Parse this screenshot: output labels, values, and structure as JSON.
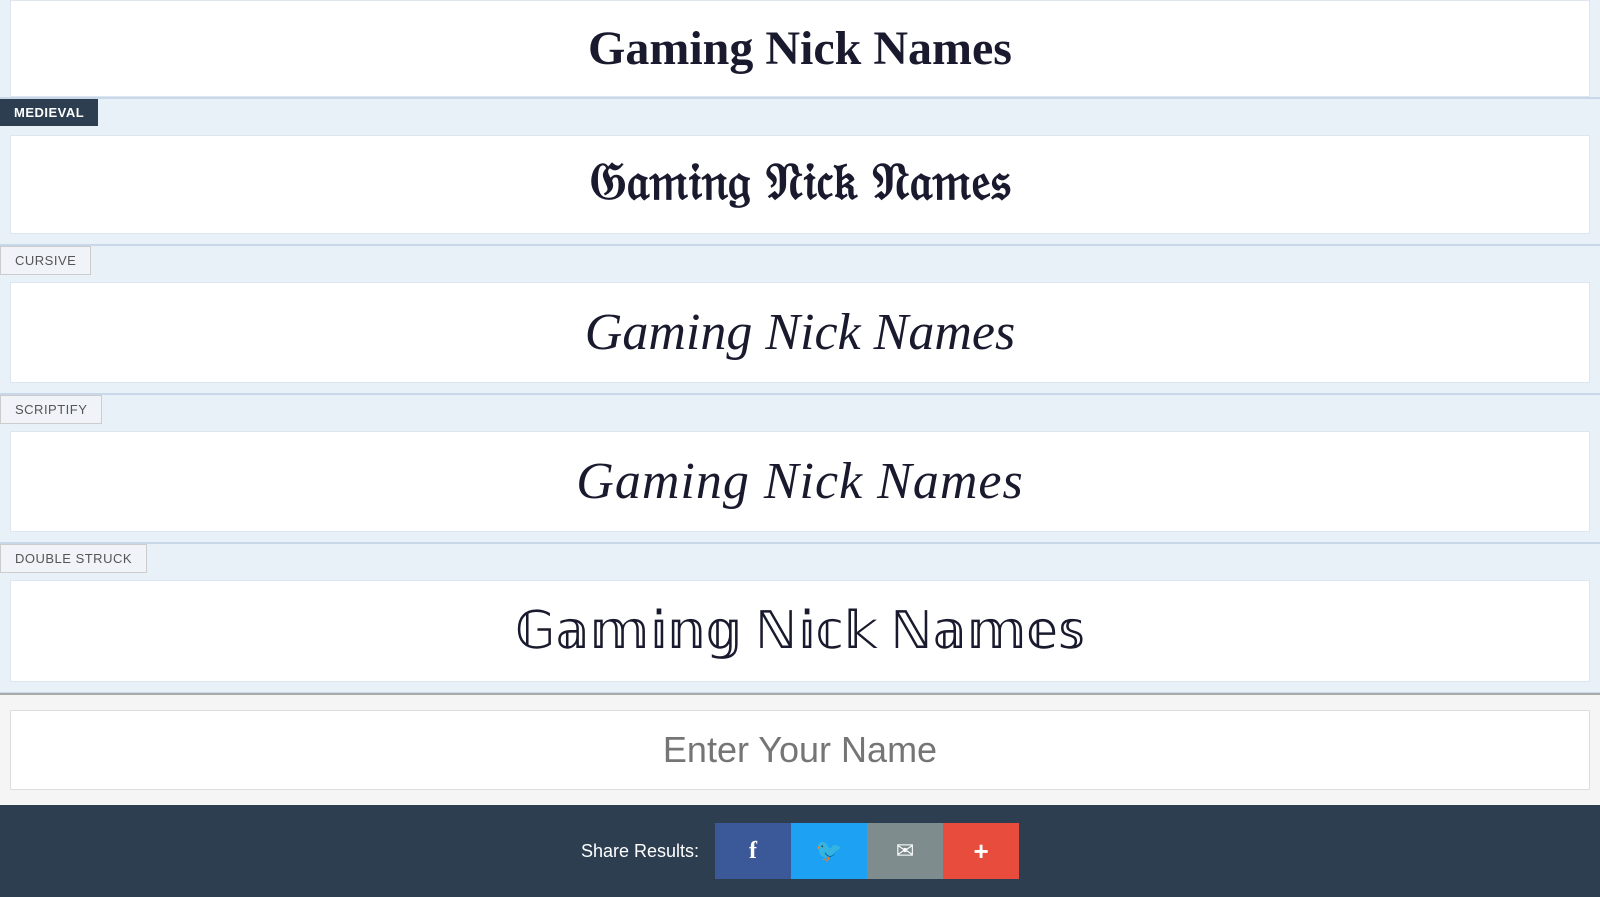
{
  "sections": [
    {
      "id": "top-preview",
      "label": null,
      "text": "Gaming Nick Names",
      "style": "top"
    },
    {
      "id": "medieval",
      "label": "MEDIEVAL",
      "label_style": "dark",
      "text": "𝔊𝔞𝔪𝔦𝔫𝔤 𝔑𝔦𝔠𝔨 𝔑𝔞𝔪𝔢𝔰",
      "style": "medieval"
    },
    {
      "id": "cursive",
      "label": "CURSIVE",
      "label_style": "light",
      "text": "Gaming Nick Names",
      "style": "cursive"
    },
    {
      "id": "scriptify",
      "label": "SCRIPTIFY",
      "label_style": "light",
      "text": "Gaming Nick Names",
      "style": "scriptify"
    },
    {
      "id": "double-struck",
      "label": "DOUBLE STRUCK",
      "label_style": "light",
      "text": "𝔾𝕒𝕞𝕚𝕟𝕘 ℕ𝕚𝕔𝕜 ℕ𝕒𝕞𝕖𝕤",
      "style": "double-struck"
    }
  ],
  "input": {
    "placeholder": "Enter Your Name"
  },
  "share": {
    "label": "Share Results:",
    "buttons": [
      {
        "id": "facebook",
        "icon": "f",
        "label": "Facebook"
      },
      {
        "id": "twitter",
        "icon": "🐦",
        "label": "Twitter"
      },
      {
        "id": "email",
        "icon": "✉",
        "label": "Email"
      },
      {
        "id": "more",
        "icon": "+",
        "label": "More"
      }
    ]
  },
  "colors": {
    "dark_label_bg": "#2c3e50",
    "dark_label_text": "#ffffff",
    "light_label_bg": "#f0f4f8",
    "light_label_text": "#555555",
    "section_bg": "#e8f0f8",
    "display_bg": "#ffffff",
    "share_bar_bg": "#2c3e50",
    "facebook_color": "#3b5998",
    "twitter_color": "#1da1f2",
    "email_color": "#7f8c8d",
    "more_color": "#e74c3c"
  }
}
